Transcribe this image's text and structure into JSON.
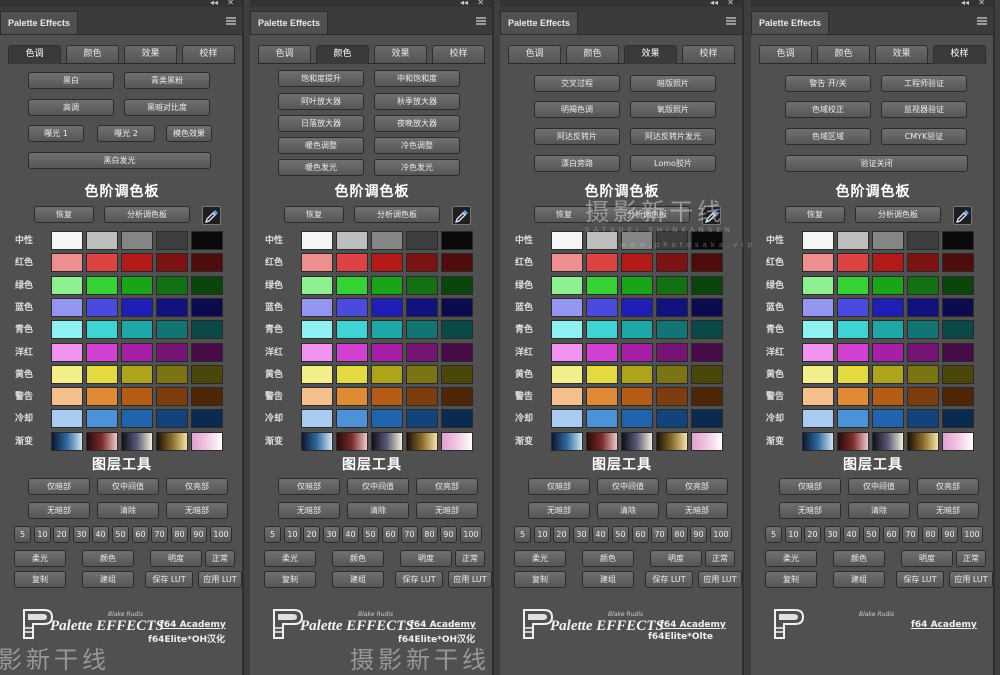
{
  "panel_title": "Palette Effects",
  "tabs": [
    "色调",
    "颜色",
    "效果",
    "校样"
  ],
  "active_tabs": [
    0,
    1,
    2,
    3
  ],
  "tab_buttons": [
    [
      "黑白",
      "青类黑粉",
      "高调",
      "黑暗对比度",
      "曝光 1",
      "曝光 2",
      "模色效果",
      "黑白发光"
    ],
    [
      "饱和度提升",
      "中和饱和度",
      "阿叶放大器",
      "秋季放大器",
      "日落放大器",
      "夜晚放大器",
      "暖色调整",
      "冷色调整",
      "暖色发光",
      "冷色发光"
    ],
    [
      "交叉过程",
      "暗版照片",
      "明褐色调",
      "氧版照片",
      "阿达反转片",
      "阿达反转片发光",
      "漂白旁路",
      "Lomo胶片"
    ],
    [
      "警告 开/关",
      "工程师验证",
      "色域校正",
      "监视器验证",
      "色域区域",
      "CMYK验证",
      "验证关闭"
    ]
  ],
  "palette_title": "色阶调色板",
  "restore_label": "恢复",
  "analyze_label": "分析调色板",
  "row_labels": [
    "中性",
    "红色",
    "绿色",
    "蓝色",
    "青色",
    "洋红",
    "黄色",
    "警告",
    "冷却",
    "渐变"
  ],
  "swatch_colors": [
    [
      "#f5f5f5",
      "#bdbdbd",
      "#858585",
      "#3e3e3e",
      "#0a0a0a"
    ],
    [
      "#ee8f8f",
      "#de4343",
      "#b31a1a",
      "#7d1212",
      "#4e0c0c"
    ],
    [
      "#8ef08e",
      "#35d135",
      "#1aa41a",
      "#137013",
      "#0c450c"
    ],
    [
      "#9595f2",
      "#4a4ade",
      "#1f1fb5",
      "#12127e",
      "#0b0b4d"
    ],
    [
      "#8ef0f0",
      "#3fd3d3",
      "#1fa6a6",
      "#137474",
      "#0b4848"
    ],
    [
      "#f093f0",
      "#d341d3",
      "#a61fa6",
      "#741474",
      "#470c47"
    ],
    [
      "#f2ee8a",
      "#e2da3e",
      "#aea41c",
      "#7b7412",
      "#4b460a"
    ],
    [
      "#f6c08c",
      "#e08a36",
      "#b55d16",
      "#7d3d0e",
      "#4f2608"
    ],
    [
      "#a9cbf1",
      "#4d91d9",
      "#2164ad",
      "#12437b",
      "#0b2a50"
    ]
  ],
  "gradients": [
    "linear-gradient(90deg,#0c1830,#2f6aa0,#d3e6f0)",
    "linear-gradient(90deg,#2a0a0a,#7a2c2c,#f0c9c9)",
    "linear-gradient(90deg,#101018,#5a5a78,#f4f0d8)",
    "linear-gradient(90deg,#1a1206,#8a6a2a,#f4e2a8)",
    "linear-gradient(90deg,#e0a0d0,#f0c8e4,#ffffff)"
  ],
  "layer_title": "图层工具",
  "layer_buttons": [
    "仅暗部",
    "仅中间值",
    "仅亮部",
    "无暗部",
    "清除",
    "无暗部"
  ],
  "opacity_values": [
    "5",
    "10",
    "20",
    "30",
    "40",
    "50",
    "60",
    "70",
    "80",
    "90",
    "100"
  ],
  "blend_buttons": [
    "柔光",
    "颜色",
    "明度",
    "正常"
  ],
  "action_buttons": [
    "复制",
    "建组",
    "保存 LUT",
    "应用 LUT"
  ],
  "logo_text": "Palette EFFECTS",
  "logo_sub": "Blake Rudis",
  "credit_line1": "f64 Academy",
  "credit_line2": [
    "f64Elite*OH汉化",
    "f64Elite*OH汉化",
    "f64Elite*Olte",
    ""
  ],
  "watermark_cn": "摄影新干线",
  "watermark_en": "SATSUEI SHINKANSEN",
  "watermark_url": "www.photosaka.vip"
}
